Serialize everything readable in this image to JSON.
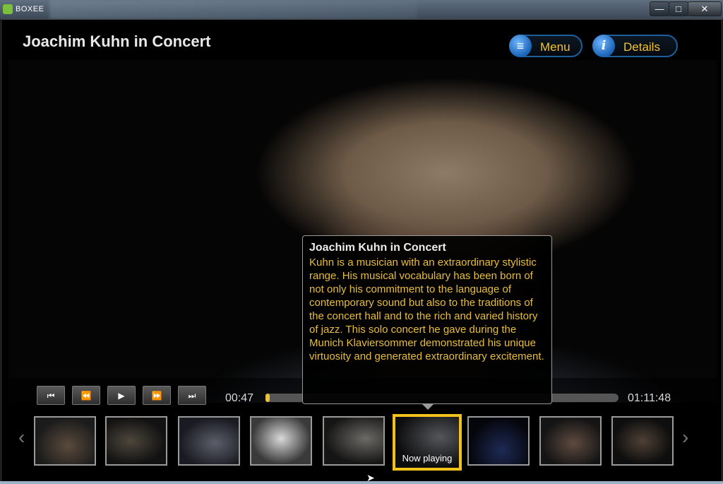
{
  "window": {
    "app_name": "BOXEE",
    "minimize": "—",
    "maximize": "□",
    "close": "✕"
  },
  "header": {
    "title": "Joachim Kuhn in Concert",
    "menu_label": "Menu",
    "details_label": "Details"
  },
  "tooltip": {
    "title": "Joachim Kuhn in Concert",
    "body": "Kuhn is a musician with an extraordinary stylistic range. His musical vocabulary has been born of not only his commitment to the language of contemporary sound but also to the traditions of the concert hall and to the rich and varied history of jazz. This solo concert he gave during the Munich Klaviersommer demonstrated his unique virtuosity and generated extraordinary excitement."
  },
  "player": {
    "elapsed": "00:47",
    "duration": "01:11:48",
    "progress_fraction": 0.011,
    "buttons": {
      "prev": "⏮",
      "rewind": "⏪",
      "play": "▶",
      "forward": "⏩",
      "next": "⏭"
    }
  },
  "strip": {
    "left_arrow": "‹",
    "right_arrow": "›",
    "now_playing_label": "Now playing",
    "active_index": 5,
    "thumb_count": 9
  },
  "colors": {
    "accent": "#f2c21b",
    "text_gold": "#e7be3b",
    "button_blue": "#1d5f9c"
  }
}
